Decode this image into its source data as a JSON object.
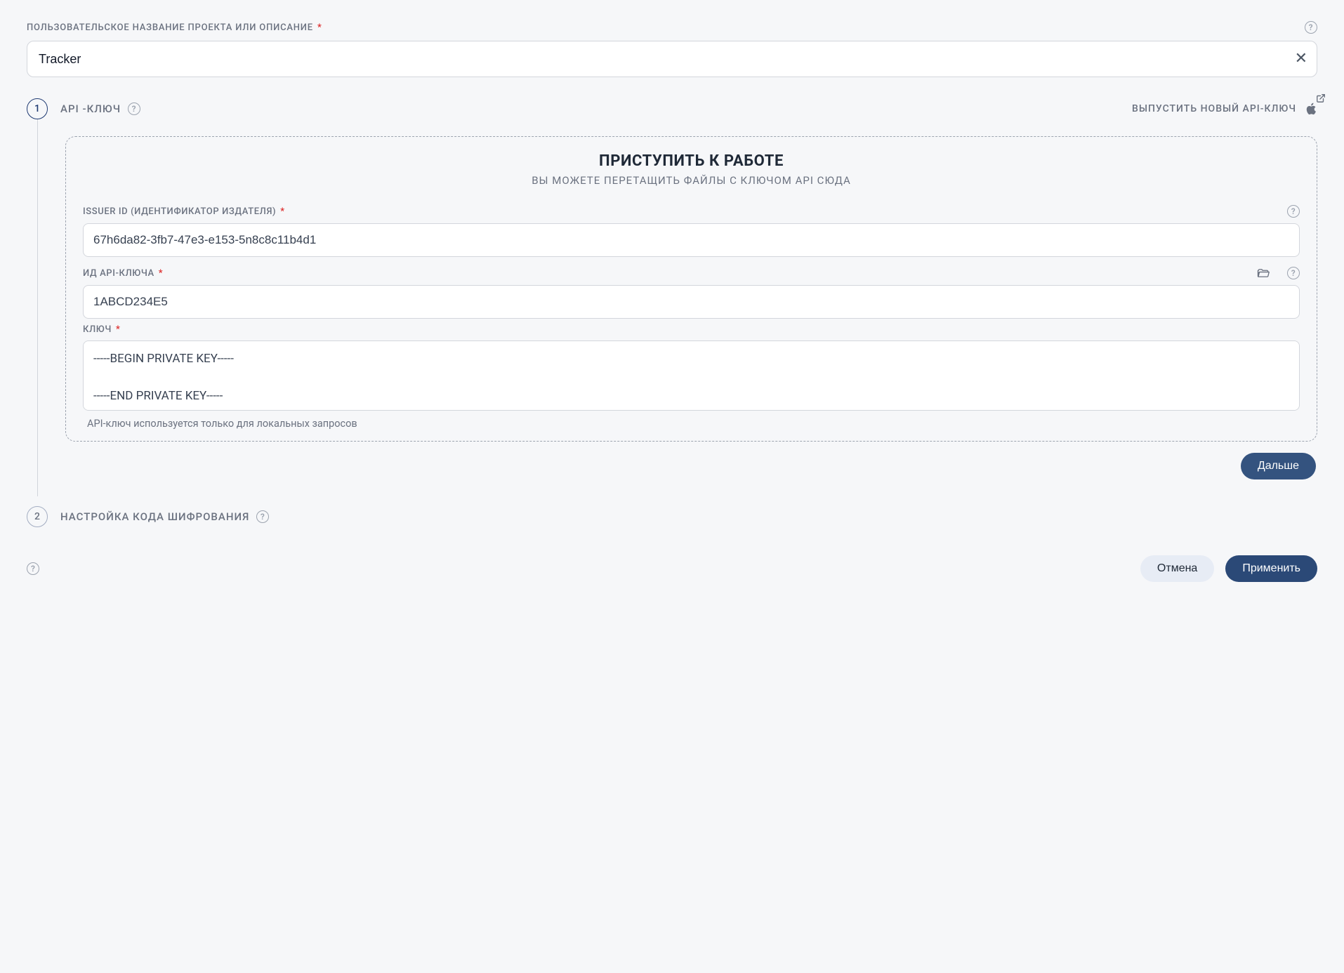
{
  "project": {
    "label": "ПОЛЬЗОВАТЕЛЬСКОЕ НАЗВАНИЕ ПРОЕКТА ИЛИ ОПИСАНИЕ",
    "value": "Tracker"
  },
  "step1": {
    "number": "1",
    "title": "API -КЛЮЧ",
    "issue_link": "ВЫПУСТИТЬ НОВЫЙ API-КЛЮЧ",
    "drop_title": "ПРИСТУПИТЬ К РАБОТЕ",
    "drop_sub": "ВЫ МОЖЕТЕ ПЕРЕТАЩИТЬ ФАЙЛЫ С КЛЮЧОМ API СЮДА",
    "issuer_label": "ISSUER ID (ИДЕНТИФИКАТОР ИЗДАТЕЛЯ)",
    "issuer_value": "67h6da82-3fb7-47e3-e153-5n8c8c11b4d1",
    "keyid_label": "ИД API-КЛЮЧА",
    "keyid_value": "1ABCD234E5",
    "key_label": "КЛЮЧ",
    "key_value": "-----BEGIN PRIVATE KEY-----\n\n-----END PRIVATE KEY-----",
    "key_helper": "API-ключ используется только для локальных запросов",
    "next": "Дальше"
  },
  "step2": {
    "number": "2",
    "title": "НАСТРОЙКА КОДА ШИФРОВАНИЯ"
  },
  "footer": {
    "cancel": "Отмена",
    "apply": "Применить"
  }
}
